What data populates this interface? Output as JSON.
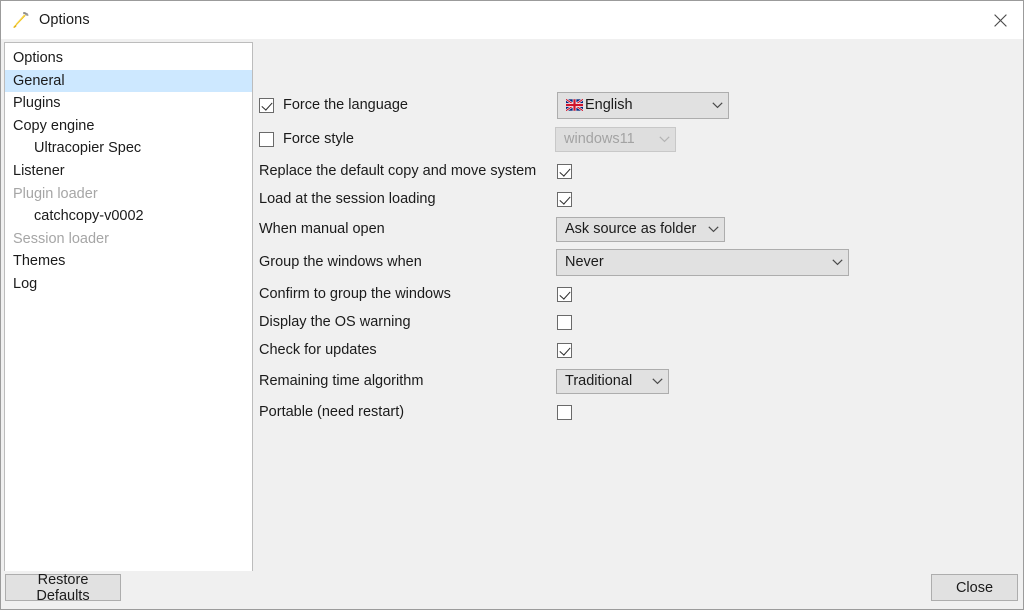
{
  "window": {
    "title": "Options",
    "icon": "hammer-icon",
    "close_icon": "close-icon"
  },
  "sidebar": {
    "items": [
      {
        "label": "Options",
        "indent": false,
        "selected": false,
        "disabled": false
      },
      {
        "label": "General",
        "indent": false,
        "selected": true,
        "disabled": false
      },
      {
        "label": "Plugins",
        "indent": false,
        "selected": false,
        "disabled": false
      },
      {
        "label": "Copy engine",
        "indent": false,
        "selected": false,
        "disabled": false
      },
      {
        "label": "Ultracopier Spec",
        "indent": true,
        "selected": false,
        "disabled": false
      },
      {
        "label": "Listener",
        "indent": false,
        "selected": false,
        "disabled": false
      },
      {
        "label": "Plugin loader",
        "indent": false,
        "selected": false,
        "disabled": true
      },
      {
        "label": "catchcopy-v0002",
        "indent": true,
        "selected": false,
        "disabled": false
      },
      {
        "label": "Session loader",
        "indent": false,
        "selected": false,
        "disabled": true
      },
      {
        "label": "Themes",
        "indent": false,
        "selected": false,
        "disabled": false
      },
      {
        "label": "Log",
        "indent": false,
        "selected": false,
        "disabled": false
      }
    ]
  },
  "settings": {
    "force_language": {
      "label": "Force the language",
      "checked": true,
      "value": "English",
      "flag": "uk-flag-icon"
    },
    "force_style": {
      "label": "Force style",
      "checked": false,
      "value": "windows11",
      "disabled": true
    },
    "replace_default": {
      "label": "Replace the default copy and move system",
      "checked": true
    },
    "load_session": {
      "label": "Load at the session loading",
      "checked": true
    },
    "manual_open": {
      "label": "When manual open",
      "value": "Ask source as folder"
    },
    "group_windows": {
      "label": "Group the windows when",
      "value": "Never"
    },
    "confirm_group": {
      "label": "Confirm to group the windows",
      "checked": true
    },
    "os_warning": {
      "label": "Display the OS warning",
      "checked": false
    },
    "check_updates": {
      "label": "Check for updates",
      "checked": true
    },
    "remaining_time": {
      "label": "Remaining time algorithm",
      "value": "Traditional"
    },
    "portable": {
      "label": "Portable (need restart)",
      "checked": false
    }
  },
  "footer": {
    "restore_label": "Restore Defaults",
    "close_label": "Close"
  },
  "colors": {
    "selection": "#cde8ff",
    "panel_bg": "#f0f0f0",
    "control_bg": "#e1e1e1",
    "text": "#1b1b1b",
    "disabled_text": "#a6a6a6"
  }
}
